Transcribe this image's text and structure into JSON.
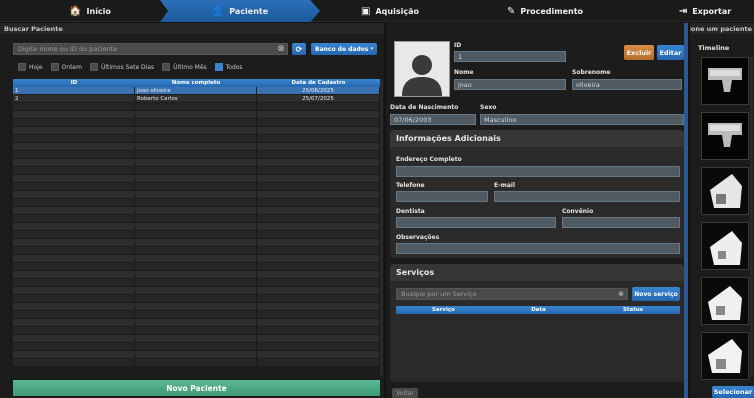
{
  "nav": {
    "items": [
      {
        "label": "Início",
        "icon": "home-icon"
      },
      {
        "label": "Paciente",
        "icon": "person-icon"
      },
      {
        "label": "Aquisição",
        "icon": "camera-icon"
      },
      {
        "label": "Procedimento",
        "icon": "edit-icon"
      },
      {
        "label": "Exportar",
        "icon": "export-icon"
      }
    ],
    "active": "Paciente"
  },
  "left": {
    "section_title": "Buscar Paciente",
    "search_placeholder": "Digite nome ou ID do paciente",
    "database_label": "Banco de dados",
    "filters": [
      {
        "label": "Hoje",
        "checked": false
      },
      {
        "label": "Ontem",
        "checked": false
      },
      {
        "label": "Últimos Sete Dias",
        "checked": false
      },
      {
        "label": "Último Mês",
        "checked": false
      },
      {
        "label": "Todos",
        "checked": true
      }
    ],
    "table": {
      "headers": [
        "ID",
        "Nome completo",
        "Data de Cadastro"
      ],
      "rows": [
        [
          "1",
          "joao oliveira",
          "25/06/2025"
        ],
        [
          "2",
          "Roberto Carlos",
          "25/07/2025"
        ]
      ]
    },
    "new_patient_label": "Novo Paciente"
  },
  "mid": {
    "id_label": "ID",
    "id_value": "1",
    "delete_label": "Excluir",
    "edit_label": "Editar",
    "first_name_label": "Nome",
    "first_name_value": "joao",
    "last_name_label": "Sobrenome",
    "last_name_value": "oliveira",
    "birth_label": "Data de Nascimento",
    "birth_value": "07/06/2003",
    "sex_label": "Sexo",
    "sex_value": "Masculino",
    "additional_title": "Informações Adicionais",
    "address_label": "Endereço Completo",
    "phone_label": "Telefone",
    "email_label": "E-mail",
    "dentist_label": "Dentista",
    "insurance_label": "Convênio",
    "notes_label": "Observações",
    "services_title": "Serviços",
    "services_search_placeholder": "Busque por um Serviço",
    "new_service_label": "Novo serviço",
    "services_headers": [
      "Serviço",
      "Data",
      "Status"
    ],
    "back_label": "Voltar"
  },
  "right": {
    "section_title": "Selecione um paciente",
    "timeline_label": "Timeline",
    "select_label": "Selecionar"
  }
}
